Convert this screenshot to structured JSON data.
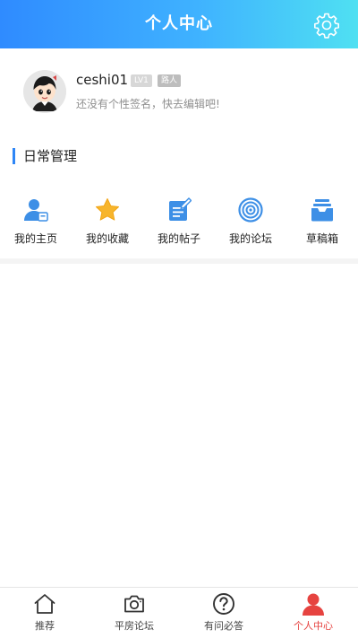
{
  "header": {
    "title": "个人中心",
    "settings_icon": "gear-icon"
  },
  "profile": {
    "username": "ceshi01",
    "level_badge": "LV1",
    "role_badge": "路人",
    "signature": "还没有个性签名，快去编辑吧!"
  },
  "daily": {
    "title": "日常管理",
    "items": [
      {
        "label": "我的主页",
        "icon": "user-home-icon"
      },
      {
        "label": "我的收藏",
        "icon": "star-icon"
      },
      {
        "label": "我的帖子",
        "icon": "edit-post-icon"
      },
      {
        "label": "我的论坛",
        "icon": "forum-target-icon"
      },
      {
        "label": "草稿箱",
        "icon": "drafts-tray-icon"
      }
    ]
  },
  "tabbar": {
    "items": [
      {
        "label": "推荐",
        "icon": "home-icon"
      },
      {
        "label": "平房论坛",
        "icon": "camera-icon"
      },
      {
        "label": "有问必答",
        "icon": "question-icon"
      },
      {
        "label": "个人中心",
        "icon": "person-icon",
        "active": true
      }
    ]
  },
  "colors": {
    "header_gradient_start": "#2f8bff",
    "header_gradient_end": "#4fe0f2",
    "accent_blue": "#2e86f6",
    "active_tab": "#e64340"
  }
}
